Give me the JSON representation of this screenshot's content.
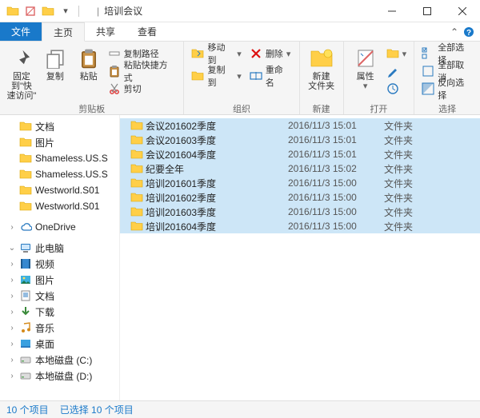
{
  "titlebar": {
    "title": "培训会议"
  },
  "tabs": {
    "file": "文件",
    "home": "主页",
    "share": "共享",
    "view": "查看"
  },
  "ribbon": {
    "clipboard": {
      "label": "剪贴板",
      "pin": "固定到\"快\n速访问\"",
      "copy": "复制",
      "paste": "粘贴",
      "copy_path": "复制路径",
      "paste_shortcut": "粘贴快捷方式",
      "cut": "剪切"
    },
    "organize": {
      "label": "组织",
      "move_to": "移动到",
      "copy_to": "复制到",
      "delete": "删除",
      "rename": "重命名"
    },
    "new_": {
      "label": "新建",
      "new_folder": "新建\n文件夹"
    },
    "open_": {
      "label": "打开",
      "properties": "属性"
    },
    "select_": {
      "label": "选择",
      "select_all": "全部选择",
      "select_none": "全部取消",
      "invert": "反向选择"
    }
  },
  "nav": [
    {
      "tw": "",
      "type": "folder",
      "label": "文档"
    },
    {
      "tw": "",
      "type": "folder",
      "label": "图片"
    },
    {
      "tw": "",
      "type": "folder",
      "label": "Shameless.US.S"
    },
    {
      "tw": "",
      "type": "folder",
      "label": "Shameless.US.S"
    },
    {
      "tw": "",
      "type": "folder",
      "label": "Westworld.S01"
    },
    {
      "tw": "",
      "type": "folder",
      "label": "Westworld.S01"
    },
    {
      "sep": true
    },
    {
      "tw": "›",
      "type": "onedrive",
      "label": "OneDrive"
    },
    {
      "sep": true
    },
    {
      "tw": "⌄",
      "type": "pc",
      "label": "此电脑"
    },
    {
      "tw": "›",
      "type": "videos",
      "label": "视频"
    },
    {
      "tw": "›",
      "type": "pictures",
      "label": "图片"
    },
    {
      "tw": "›",
      "type": "documents",
      "label": "文档"
    },
    {
      "tw": "›",
      "type": "downloads",
      "label": "下载"
    },
    {
      "tw": "›",
      "type": "music",
      "label": "音乐"
    },
    {
      "tw": "›",
      "type": "desktop",
      "label": "桌面"
    },
    {
      "tw": "›",
      "type": "disk",
      "label": "本地磁盘 (C:)"
    },
    {
      "tw": "›",
      "type": "disk",
      "label": "本地磁盘 (D:)"
    }
  ],
  "files": [
    {
      "name": "会议201602季度",
      "date": "2016/11/3 15:01",
      "type": "文件夹"
    },
    {
      "name": "会议201603季度",
      "date": "2016/11/3 15:01",
      "type": "文件夹"
    },
    {
      "name": "会议201604季度",
      "date": "2016/11/3 15:01",
      "type": "文件夹"
    },
    {
      "name": "纪要全年",
      "date": "2016/11/3 15:02",
      "type": "文件夹"
    },
    {
      "name": "培训201601季度",
      "date": "2016/11/3 15:00",
      "type": "文件夹"
    },
    {
      "name": "培训201602季度",
      "date": "2016/11/3 15:00",
      "type": "文件夹"
    },
    {
      "name": "培训201603季度",
      "date": "2016/11/3 15:00",
      "type": "文件夹"
    },
    {
      "name": "培训201604季度",
      "date": "2016/11/3 15:00",
      "type": "文件夹"
    }
  ],
  "status": {
    "count": "10 个项目",
    "selected": "已选择 10 个项目"
  }
}
